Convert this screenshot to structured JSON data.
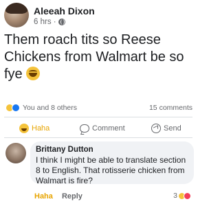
{
  "post": {
    "author": "Aleeah Dixon",
    "meta": "6 hrs ·",
    "text": "Them roach tits so Reese Chickens from Walmart be so fye"
  },
  "reactions": {
    "summary": "You and 8 others",
    "comments": "15 comments",
    "icons": [
      "haha-icon",
      "like-icon"
    ]
  },
  "actions": {
    "haha": "Haha",
    "comment": "Comment",
    "send": "Send"
  },
  "comment": {
    "author": "Brittany Dutton",
    "text": "I think I might be able to translate section 8 to English. That rotisserie chicken from Walmart is fire?",
    "haha": "Haha",
    "reply": "Reply",
    "reaction_count": "3"
  },
  "colors": {
    "haha": "#e7a400",
    "link": "#1877f2",
    "muted": "#65676b",
    "bubble": "#f0f2f5"
  }
}
